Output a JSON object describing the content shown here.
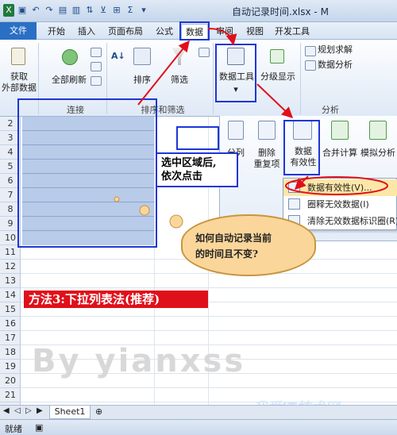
{
  "window": {
    "title": "自动记录时间.xlsx - M"
  },
  "tabs": [
    {
      "label": "文件"
    },
    {
      "label": "开始"
    },
    {
      "label": "插入"
    },
    {
      "label": "页面布局"
    },
    {
      "label": "公式"
    },
    {
      "label": "数据"
    },
    {
      "label": "审阅"
    },
    {
      "label": "视图"
    },
    {
      "label": "开发工具"
    }
  ],
  "ribbon": {
    "get_external_line1": "获取",
    "get_external_line2": "外部数据",
    "refresh_all": "全部刷新",
    "sort": "排序",
    "filter": "筛选",
    "data_tools": "数据工具",
    "outline": "分级显示",
    "solver": "规划求解",
    "data_analysis": "数据分析",
    "group_connections": "连接",
    "group_sort_filter": "排序和筛选",
    "group_analysis": "分析"
  },
  "panel": {
    "text_to_col": "分列",
    "remove_dup_line1": "删除",
    "remove_dup_line2": "重复项",
    "validation_line1": "数据",
    "validation_line2": "有效性",
    "consolidate": "合并计算",
    "whatif": "模拟分析"
  },
  "menu": {
    "items": [
      {
        "label": "数据有效性(V)..."
      },
      {
        "label": "圈释无效数据(I)"
      },
      {
        "label": "清除无效数据标识圈(R)"
      }
    ]
  },
  "rows": [
    "2",
    "3",
    "4",
    "5",
    "6",
    "7",
    "8",
    "9",
    "10",
    "11",
    "12",
    "13",
    "14",
    "15",
    "16",
    "17",
    "18",
    "19",
    "20",
    "21"
  ],
  "annotations": {
    "callout_line1": "选中区域后,",
    "callout_line2": "依次点击",
    "cloud_line1": "如何自动记录当前",
    "cloud_line2": "的时间且不变?",
    "method": "方法3:下拉列表法(推荐)",
    "watermark": "By yianxss",
    "site": "我爱IT技术网"
  },
  "sheet_tab": "Sheet1",
  "status": {
    "ready": "就绪"
  }
}
